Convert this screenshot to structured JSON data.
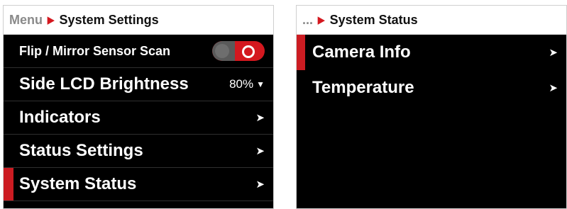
{
  "left_panel": {
    "breadcrumb": {
      "parent": "Menu",
      "current": "System Settings"
    },
    "rows": [
      {
        "label": "Flip / Mirror Sensor Scan",
        "toggle_on": true
      },
      {
        "label": "Side LCD Brightness",
        "value": "80%"
      },
      {
        "label": "Indicators"
      },
      {
        "label": "Status Settings"
      },
      {
        "label": "System Status",
        "selected": true
      }
    ]
  },
  "right_panel": {
    "breadcrumb": {
      "parent": "...",
      "current": "System Status"
    },
    "rows": [
      {
        "label": "Camera Info",
        "selected": true
      },
      {
        "label": "Temperature"
      }
    ]
  },
  "colors": {
    "accent": "#cc1c22",
    "panel_bg": "#000000",
    "header_bg": "#ffffff"
  }
}
